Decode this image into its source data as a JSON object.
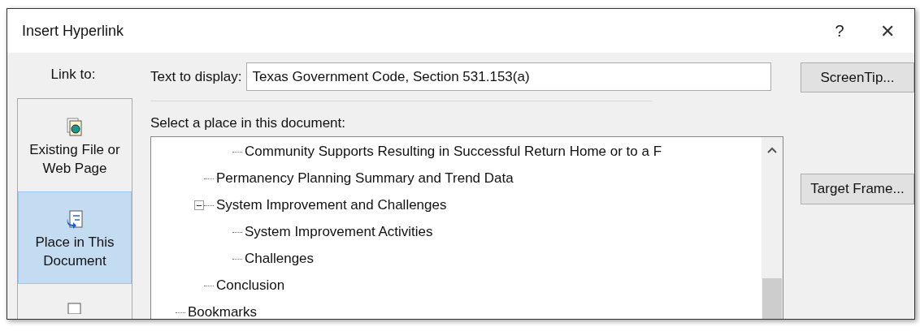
{
  "window": {
    "title": "Insert Hyperlink",
    "help": "?",
    "close": "✕"
  },
  "link_to": {
    "label": "Link to:",
    "items": [
      {
        "label": "Existing File or Web Page",
        "kind": "file",
        "selected": false
      },
      {
        "label": "Place in This Document",
        "kind": "place",
        "selected": true
      },
      {
        "kind": "new",
        "selected": false
      }
    ]
  },
  "text_to_display": {
    "label": "Text to display:",
    "value": "Texas Government Code, Section 531.153(a)"
  },
  "screentip_button": "ScreenTip...",
  "place_label": "Select a place in this document:",
  "tree": [
    {
      "children": [
        {
          "children": [
            {
              "label": "Community Supports Resulting in Successful Return Home or to a F"
            }
          ]
        },
        {
          "label": "Permanency Planning Summary and Trend Data"
        },
        {
          "label": "System Improvement and Challenges",
          "expanded": true,
          "children": [
            {
              "label": "System Improvement Activities"
            },
            {
              "label": "Challenges"
            }
          ]
        },
        {
          "label": "Conclusion"
        }
      ]
    },
    {
      "label": "Bookmarks"
    }
  ],
  "target_frame_button": "Target Frame..."
}
